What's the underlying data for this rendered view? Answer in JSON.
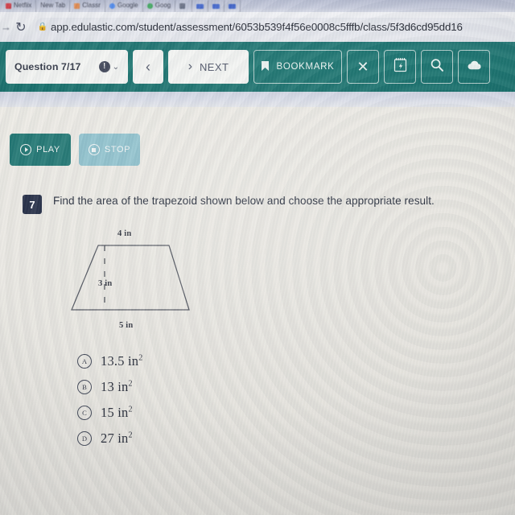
{
  "browser": {
    "bookmarks": [
      {
        "label": "Netflix",
        "icon": "netflix-icon",
        "color": "#d5202a"
      },
      {
        "label": "New Tab",
        "icon": "newtab-icon",
        "color": "#9aa0b4"
      },
      {
        "label": "Classr",
        "icon": "classroom-icon",
        "color": "#e9833a"
      },
      {
        "label": "Google",
        "icon": "google-icon",
        "color": "#4285f4"
      },
      {
        "label": "Goog",
        "icon": "google-icon",
        "color": "#34a853"
      },
      {
        "label": "",
        "icon": "folder-icon",
        "color": "#5b6378"
      }
    ],
    "nav_back_icon": "back-arrow-icon",
    "reload_icon": "reload-icon",
    "lock_icon": "lock-icon",
    "url": "app.edulastic.com/student/assessment/6053b539f4f56e0008c5fffb/class/5f3d6cd95dd16"
  },
  "toolbar": {
    "question_label": "Question 7/17",
    "info_icon": "info-icon",
    "info_glyph": "!",
    "chevron_icon": "chevron-down-icon",
    "chevron_glyph": "⌄",
    "prev_icon": "chevron-left-icon",
    "prev_glyph": "‹",
    "next_icon": "chevron-right-icon",
    "next_glyph": "›",
    "next_label": "NEXT",
    "bookmark_icon": "bookmark-flag-icon",
    "bookmark_glyph": "⚑",
    "bookmark_label": "BOOKMARK",
    "close_icon": "close-x-icon",
    "close_glyph": "✕",
    "notepad_icon": "notepad-icon",
    "notepad_glyph": "Ὕ2",
    "magnify_icon": "magnifier-icon",
    "magnify_glyph": "⚲",
    "cloud_icon": "cloud-icon",
    "cloud_glyph": "☁",
    "accent_color": "#14716c"
  },
  "audio": {
    "play_label": "PLAY",
    "play_icon": "play-circle-icon",
    "play_color": "#1a736f",
    "stop_label": "STOP",
    "stop_icon": "stop-circle-icon",
    "stop_color": "#8cc0cc"
  },
  "question": {
    "number": "7",
    "text": "Find the area of the trapezoid shown below and choose the appropriate result."
  },
  "figure": {
    "shape": "trapezoid",
    "top_label": "4 in",
    "height_label": "3 in",
    "bottom_label": "5 in",
    "stroke_color": "#4a4e58"
  },
  "choices": [
    {
      "letter": "A",
      "value": "13.5 in",
      "exponent": "2"
    },
    {
      "letter": "B",
      "value": "13 in",
      "exponent": "2"
    },
    {
      "letter": "C",
      "value": "15 in",
      "exponent": "2"
    },
    {
      "letter": "D",
      "value": "27 in",
      "exponent": "2"
    }
  ]
}
